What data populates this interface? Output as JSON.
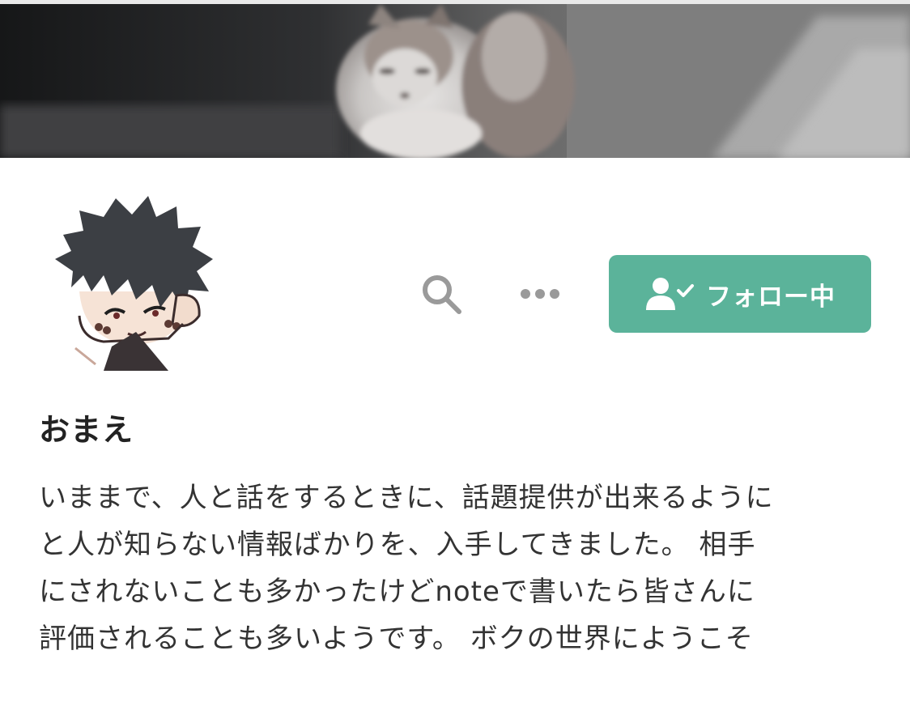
{
  "header_image": {
    "description_icon": "cover-photo-cat"
  },
  "profile": {
    "avatar_icon": "avatar-illustration",
    "name": "おまえ",
    "bio_lines": [
      "いままで、人と話をするときに、話題提供が出来るように",
      "と人が知らない情報ばかりを、入手してきました。 相手",
      "にされないことも多かったけどnoteで書いたら皆さんに",
      "評価されることも多いようです。 ボクの世界にようこそ"
    ]
  },
  "actions": {
    "search_icon": "search-icon",
    "more_icon": "more-icon",
    "follow_label": "フォロー中",
    "follow_icon": "user-check-icon"
  },
  "colors": {
    "accent": "#5bb39a",
    "icon_gray": "#9a9a9a",
    "text": "#222222"
  }
}
